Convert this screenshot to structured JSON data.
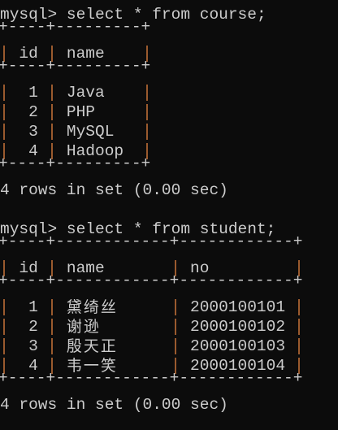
{
  "terminal": {
    "background": "#0c0c0c",
    "text_color": "#cccccc",
    "border_color": "#9a5a2e"
  },
  "queries": [
    {
      "prompt": "mysql> select * from course;",
      "border": "+----+---------+",
      "columns": [
        "id",
        "name"
      ],
      "rows": [
        [
          "1",
          "Java"
        ],
        [
          "2",
          "PHP"
        ],
        [
          "3",
          "MySQL"
        ],
        [
          "4",
          "Hadoop"
        ]
      ],
      "result": "4 rows in set (0.00 sec)"
    },
    {
      "prompt": "mysql> select * from student;",
      "border": "+----+------------+------------+",
      "columns": [
        "id",
        "name",
        "no"
      ],
      "rows": [
        [
          "1",
          "黛绮丝",
          "2000100101"
        ],
        [
          "2",
          "谢逊",
          "2000100102"
        ],
        [
          "3",
          "殷天正",
          "2000100103"
        ],
        [
          "4",
          "韦一笑",
          "2000100104"
        ]
      ],
      "result": "4 rows in set (0.00 sec)"
    }
  ]
}
